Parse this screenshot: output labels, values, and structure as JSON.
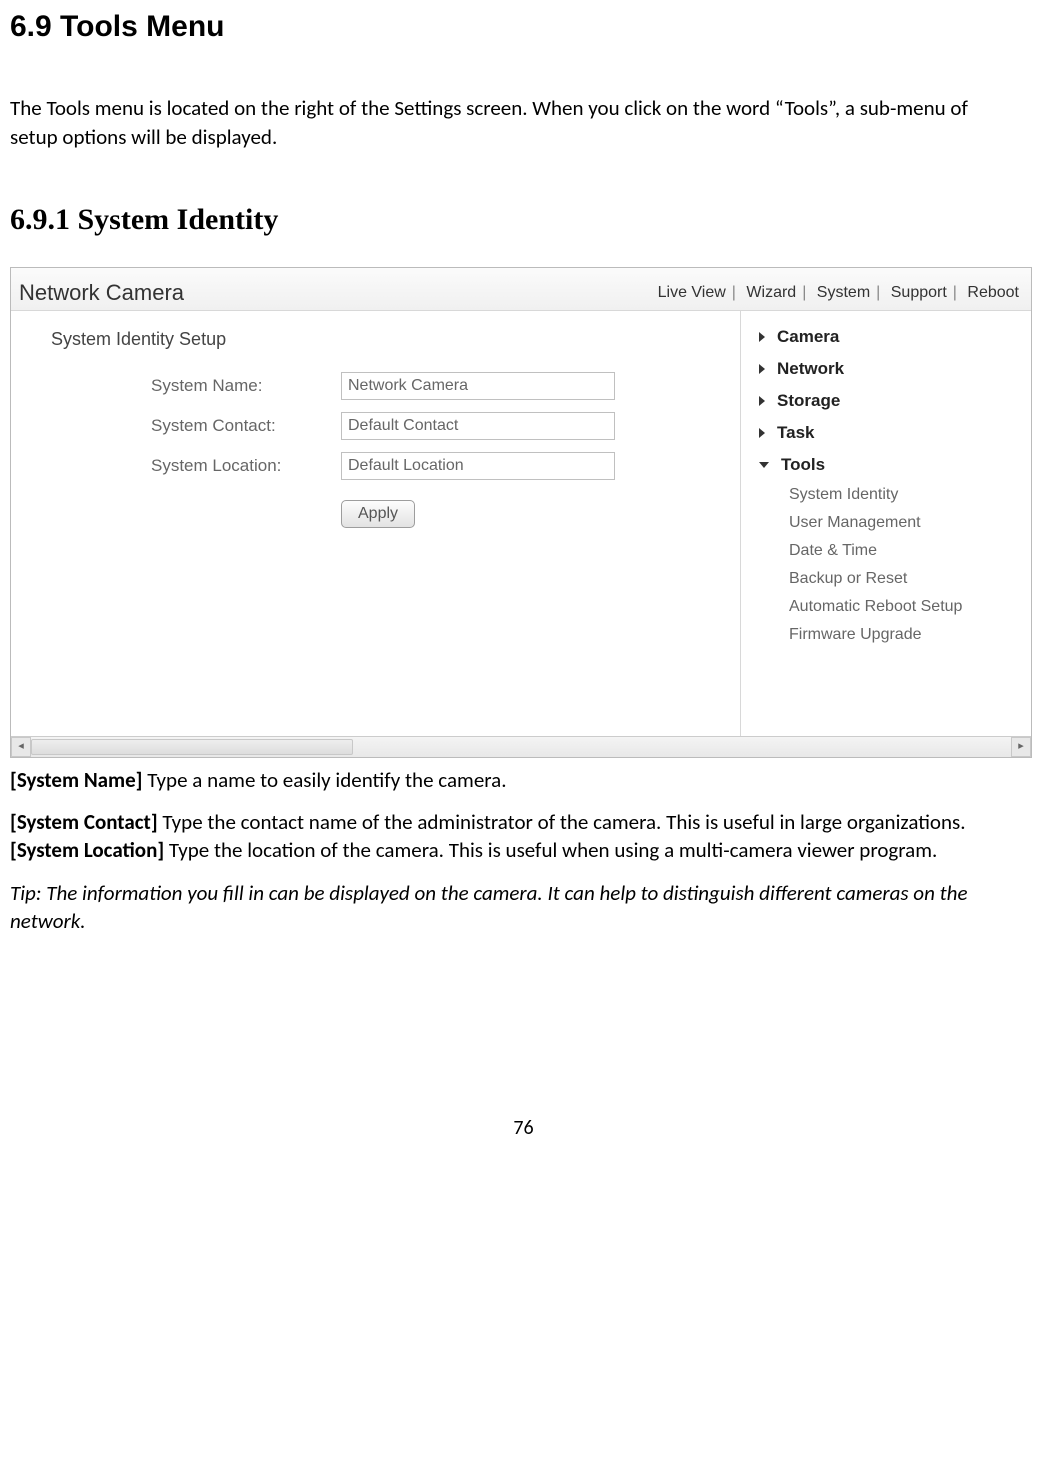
{
  "headings": {
    "h1": "6.9 Tools Menu",
    "intro": "The Tools menu is located on the right of the Settings screen. When you click on the word “Tools”, a sub-menu of setup options will be displayed.",
    "h2": "6.9.1 System Identity"
  },
  "screenshot": {
    "title": "Network Camera",
    "topnav": [
      "Live View",
      "Wizard",
      "System",
      "Support",
      "Reboot"
    ],
    "panel_title": "System Identity Setup",
    "fields": {
      "name_label": "System Name:",
      "name_value": "Network Camera",
      "contact_label": "System Contact:",
      "contact_value": "Default Contact",
      "location_label": "System Location:",
      "location_value": "Default Location"
    },
    "apply_label": "Apply",
    "sidebar": {
      "collapsed": [
        "Camera",
        "Network",
        "Storage",
        "Task"
      ],
      "expanded_label": "Tools",
      "sub": [
        "System Identity",
        "User Management",
        "Date & Time",
        "Backup or Reset",
        "Automatic Reboot Setup",
        "Firmware Upgrade"
      ]
    }
  },
  "desc": {
    "p1_bold": "[System Name]",
    "p1_rest": " Type a name to easily identify the camera.",
    "p2_b1": "[System Contact]",
    "p2_t1": " Type the contact name of the administrator of the camera. This is useful in large organizations. ",
    "p2_b2": "[System Location]",
    "p2_t2": " Type the location of the camera. This is useful when using a multi-camera viewer program.",
    "tip": "Tip: The information you fill in can be displayed on the camera. It can help to distinguish different cameras on the network."
  },
  "page_number": "76"
}
